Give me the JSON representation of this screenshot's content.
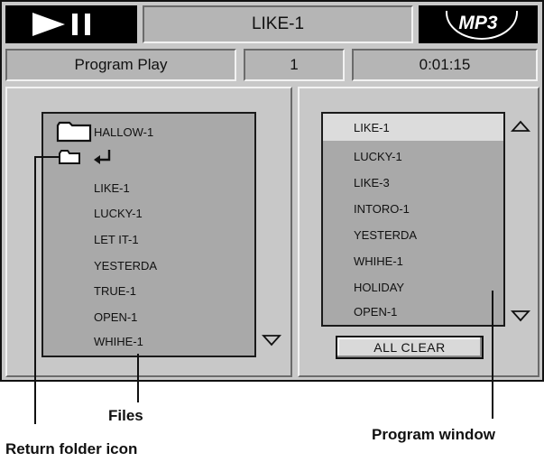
{
  "header": {
    "play_pause_icon": "play-pause-icon",
    "track_title": "LIKE-1",
    "format_badge": "MP3"
  },
  "status": {
    "mode": "Program Play",
    "track_number": "1",
    "time": "0:01:15"
  },
  "files": {
    "items": [
      "HALLOW-1",
      "LIKE-1",
      "LUCKY-1",
      "LET IT-1",
      "YESTERDA",
      "TRUE-1",
      "OPEN-1",
      "WHIHE-1"
    ]
  },
  "program": {
    "items": [
      "LIKE-1",
      "LUCKY-1",
      "LIKE-3",
      "INTORO-1",
      "YESTERDA",
      "WHIHE-1",
      "HOLIDAY",
      "OPEN-1"
    ],
    "selected_index": 0,
    "clear_button": "ALL CLEAR"
  },
  "callouts": {
    "files": "Files",
    "return_folder_icon": "Return folder icon",
    "program_window": "Program window"
  }
}
